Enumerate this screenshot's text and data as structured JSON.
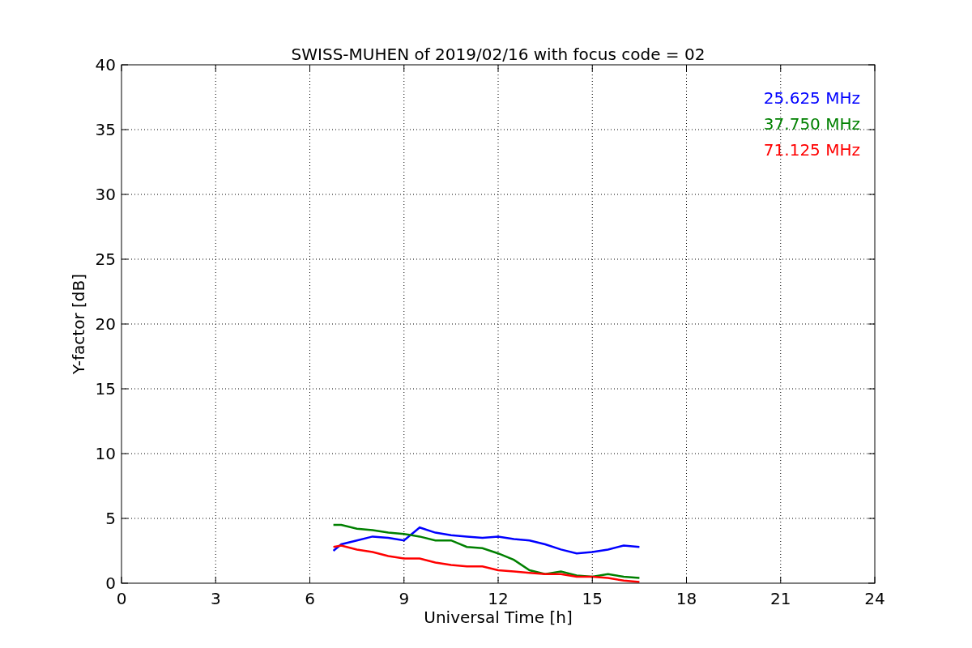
{
  "chart_data": {
    "type": "line",
    "title": "SWISS-MUHEN of 2019/02/16 with focus code = 02",
    "xlabel": "Universal Time [h]",
    "ylabel": "Y-factor [dB]",
    "x": [
      6.75,
      7,
      7.5,
      8,
      8.5,
      9,
      9.5,
      10,
      10.5,
      11,
      11.5,
      12,
      12.5,
      13,
      13.5,
      14,
      14.5,
      15,
      15.5,
      16,
      16.5
    ],
    "series": [
      {
        "name": "25.625 MHz",
        "color": "#0000ff",
        "values": [
          2.5,
          3.0,
          3.3,
          3.6,
          3.5,
          3.3,
          4.3,
          3.9,
          3.7,
          3.6,
          3.5,
          3.6,
          3.4,
          3.3,
          3.0,
          2.6,
          2.3,
          2.4,
          2.6,
          2.9,
          2.8
        ]
      },
      {
        "name": "37.750 MHz",
        "color": "#008000",
        "values": [
          4.5,
          4.5,
          4.2,
          4.1,
          3.9,
          3.8,
          3.6,
          3.3,
          3.3,
          2.8,
          2.7,
          2.3,
          1.8,
          1.0,
          0.7,
          0.9,
          0.6,
          0.5,
          0.7,
          0.5,
          0.4
        ]
      },
      {
        "name": "71.125 MHz",
        "color": "#ff0000",
        "values": [
          2.8,
          2.9,
          2.6,
          2.4,
          2.1,
          1.9,
          1.9,
          1.6,
          1.4,
          1.3,
          1.3,
          1.0,
          0.9,
          0.8,
          0.7,
          0.7,
          0.5,
          0.5,
          0.4,
          0.2,
          0.1
        ]
      }
    ],
    "grid": true,
    "xlim": [
      0,
      24
    ],
    "ylim": [
      0,
      40
    ],
    "xticks": [
      0,
      3,
      6,
      9,
      12,
      15,
      18,
      21,
      24
    ],
    "yticks": [
      0,
      5,
      10,
      15,
      20,
      25,
      30,
      35,
      40
    ]
  }
}
